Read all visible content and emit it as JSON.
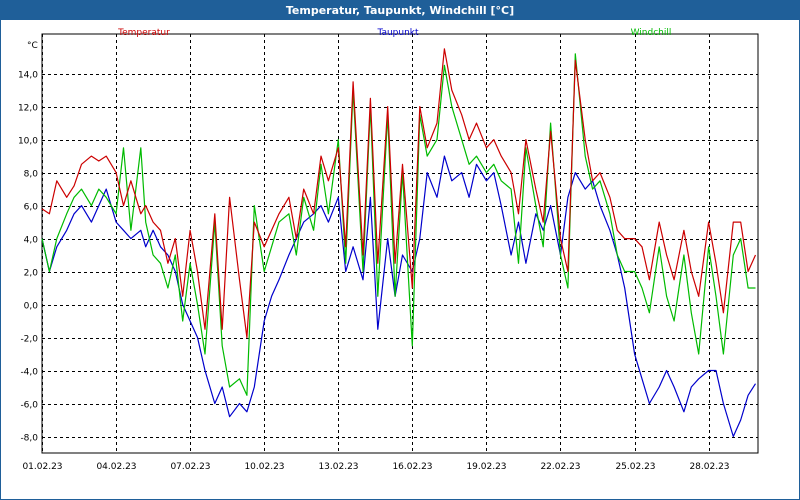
{
  "window": {
    "title": "Temperatur, Taupunkt, Windchill [°C]"
  },
  "chart_data": {
    "type": "line",
    "title": "Temperatur, Taupunkt, Windchill [°C]",
    "ylabel": "°C",
    "xlabel": "",
    "ylim": [
      -9.0,
      16.4
    ],
    "xlim": [
      1.0,
      30.0
    ],
    "y_ticks": [
      14.0,
      12.0,
      10.0,
      8.0,
      6.0,
      4.0,
      2.0,
      0.0,
      -2.0,
      -4.0,
      -6.0,
      -8.0
    ],
    "y_tick_labels": [
      "14,0",
      "12,0",
      "10,0",
      "8,0",
      "6,0",
      "4,0",
      "2,0",
      "0,0",
      "-2,0",
      "-4,0",
      "-6,0",
      "-8,0"
    ],
    "x_ticks": [
      1,
      4,
      7,
      10,
      13,
      16,
      19,
      22,
      25,
      28
    ],
    "x_tick_labels": [
      "01.02.23",
      "04.02.23",
      "07.02.23",
      "10.02.23",
      "13.02.23",
      "16.02.23",
      "19.02.23",
      "22.02.23",
      "25.02.23",
      "28.02.23"
    ],
    "grid": true,
    "legend_position": "top",
    "series": [
      {
        "name": "Temperatur",
        "color": "#cc0000",
        "x": [
          1.0,
          1.3,
          1.6,
          2.0,
          2.3,
          2.6,
          3.0,
          3.3,
          3.6,
          4.0,
          4.3,
          4.6,
          5.0,
          5.2,
          5.5,
          5.8,
          6.1,
          6.4,
          6.7,
          7.0,
          7.3,
          7.6,
          8.0,
          8.3,
          8.6,
          9.0,
          9.3,
          9.6,
          10.0,
          10.3,
          10.6,
          11.0,
          11.3,
          11.6,
          12.0,
          12.3,
          12.6,
          13.0,
          13.3,
          13.6,
          14.0,
          14.3,
          14.6,
          15.0,
          15.3,
          15.6,
          16.0,
          16.3,
          16.6,
          17.0,
          17.3,
          17.6,
          18.0,
          18.3,
          18.6,
          19.0,
          19.3,
          19.6,
          20.0,
          20.3,
          20.6,
          21.0,
          21.3,
          21.6,
          22.0,
          22.3,
          22.6,
          23.0,
          23.3,
          23.6,
          24.0,
          24.3,
          24.6,
          25.0,
          25.3,
          25.6,
          26.0,
          26.3,
          26.6,
          27.0,
          27.3,
          27.6,
          28.0,
          28.3,
          28.6,
          29.0,
          29.3,
          29.6,
          29.9
        ],
        "values": [
          5.8,
          5.5,
          7.5,
          6.5,
          7.2,
          8.5,
          9.0,
          8.7,
          9.0,
          8.0,
          6.0,
          7.5,
          5.5,
          6.0,
          5.0,
          4.5,
          2.5,
          4.0,
          0.5,
          4.5,
          2.0,
          -1.5,
          5.5,
          -1.5,
          6.5,
          1.5,
          -2.0,
          5.0,
          3.5,
          4.5,
          5.5,
          6.5,
          4.0,
          7.0,
          5.5,
          9.0,
          7.5,
          9.5,
          3.5,
          13.5,
          3.0,
          12.5,
          2.5,
          12.0,
          2.5,
          8.5,
          1.0,
          12.0,
          9.5,
          11.0,
          15.5,
          13.0,
          11.5,
          10.0,
          11.0,
          9.5,
          10.0,
          9.0,
          8.0,
          5.5,
          10.0,
          7.0,
          5.0,
          10.5,
          4.0,
          2.0,
          14.8,
          10.0,
          7.5,
          8.0,
          6.5,
          4.5,
          4.0,
          4.0,
          3.5,
          1.5,
          5.0,
          3.0,
          1.5,
          4.5,
          2.0,
          0.5,
          5.0,
          2.5,
          -0.5,
          5.0,
          5.0,
          2.0,
          3.0
        ]
      },
      {
        "name": "Taupunkt",
        "color": "#0000cc",
        "x": [
          1.0,
          1.3,
          1.6,
          2.0,
          2.3,
          2.6,
          3.0,
          3.3,
          3.6,
          4.0,
          4.3,
          4.6,
          5.0,
          5.2,
          5.5,
          5.8,
          6.1,
          6.4,
          6.7,
          7.0,
          7.3,
          7.6,
          8.0,
          8.3,
          8.6,
          9.0,
          9.3,
          9.6,
          10.0,
          10.3,
          10.6,
          11.0,
          11.3,
          11.6,
          12.0,
          12.3,
          12.6,
          13.0,
          13.3,
          13.6,
          14.0,
          14.3,
          14.6,
          15.0,
          15.3,
          15.6,
          16.0,
          16.3,
          16.6,
          17.0,
          17.3,
          17.6,
          18.0,
          18.3,
          18.6,
          19.0,
          19.3,
          19.6,
          20.0,
          20.3,
          20.6,
          21.0,
          21.3,
          21.6,
          22.0,
          22.3,
          22.6,
          23.0,
          23.3,
          23.6,
          24.0,
          24.3,
          24.6,
          25.0,
          25.3,
          25.6,
          26.0,
          26.3,
          26.6,
          27.0,
          27.3,
          27.6,
          28.0,
          28.3,
          28.6,
          29.0,
          29.3,
          29.6,
          29.9
        ],
        "values": [
          4.0,
          2.0,
          3.5,
          4.5,
          5.5,
          6.0,
          5.0,
          6.0,
          7.0,
          5.0,
          4.5,
          4.0,
          4.5,
          3.5,
          4.5,
          3.5,
          3.0,
          2.0,
          0.0,
          -1.0,
          -2.0,
          -4.0,
          -6.0,
          -5.0,
          -6.8,
          -6.0,
          -6.5,
          -5.0,
          -1.0,
          0.5,
          1.5,
          3.0,
          4.0,
          5.0,
          5.5,
          6.0,
          5.0,
          6.5,
          2.0,
          3.5,
          1.5,
          6.5,
          -1.5,
          4.0,
          0.5,
          3.0,
          2.0,
          4.0,
          8.0,
          6.5,
          9.0,
          7.5,
          8.0,
          6.5,
          8.5,
          7.5,
          8.0,
          6.0,
          3.0,
          5.0,
          2.5,
          5.5,
          4.5,
          6.0,
          3.0,
          6.5,
          8.0,
          7.0,
          7.5,
          6.0,
          4.5,
          3.0,
          1.0,
          -3.0,
          -4.5,
          -6.0,
          -5.0,
          -4.0,
          -5.0,
          -6.5,
          -5.0,
          -4.5,
          -4.0,
          -4.0,
          -6.0,
          -8.0,
          -7.0,
          -5.5,
          -4.8
        ]
      },
      {
        "name": "Windchill",
        "color": "#00bb00",
        "x": [
          1.0,
          1.3,
          1.6,
          2.0,
          2.3,
          2.6,
          3.0,
          3.3,
          3.6,
          4.0,
          4.3,
          4.6,
          5.0,
          5.2,
          5.5,
          5.8,
          6.1,
          6.4,
          6.7,
          7.0,
          7.3,
          7.6,
          8.0,
          8.3,
          8.6,
          9.0,
          9.3,
          9.6,
          10.0,
          10.3,
          10.6,
          11.0,
          11.3,
          11.6,
          12.0,
          12.3,
          12.6,
          13.0,
          13.3,
          13.6,
          14.0,
          14.3,
          14.6,
          15.0,
          15.3,
          15.6,
          16.0,
          16.3,
          16.6,
          17.0,
          17.3,
          17.6,
          18.0,
          18.3,
          18.6,
          19.0,
          19.3,
          19.6,
          20.0,
          20.3,
          20.6,
          21.0,
          21.3,
          21.6,
          22.0,
          22.3,
          22.6,
          23.0,
          23.3,
          23.6,
          24.0,
          24.3,
          24.6,
          25.0,
          25.3,
          25.6,
          26.0,
          26.3,
          26.6,
          27.0,
          27.3,
          27.6,
          28.0,
          28.3,
          28.6,
          29.0,
          29.3,
          29.6,
          29.9
        ],
        "values": [
          4.0,
          2.0,
          4.0,
          5.5,
          6.5,
          7.0,
          6.0,
          7.0,
          6.5,
          5.5,
          9.5,
          4.5,
          9.5,
          5.0,
          3.0,
          2.5,
          1.0,
          3.0,
          -1.0,
          2.5,
          0.0,
          -3.0,
          5.0,
          -2.5,
          -5.0,
          -4.5,
          -5.5,
          6.0,
          2.0,
          3.5,
          5.0,
          5.5,
          3.0,
          6.5,
          4.5,
          8.5,
          5.5,
          10.0,
          2.5,
          13.0,
          2.0,
          12.0,
          0.5,
          11.5,
          0.5,
          8.0,
          -2.5,
          11.5,
          9.0,
          10.0,
          14.5,
          12.0,
          10.0,
          8.5,
          9.0,
          8.0,
          8.5,
          7.5,
          7.0,
          2.5,
          9.5,
          6.0,
          3.5,
          11.0,
          3.0,
          1.0,
          15.2,
          9.0,
          7.0,
          7.5,
          5.5,
          3.0,
          2.0,
          2.0,
          1.0,
          -0.5,
          3.5,
          0.5,
          -1.0,
          3.0,
          -0.5,
          -3.0,
          3.5,
          0.5,
          -3.0,
          3.0,
          4.0,
          1.0,
          1.0
        ]
      }
    ]
  }
}
